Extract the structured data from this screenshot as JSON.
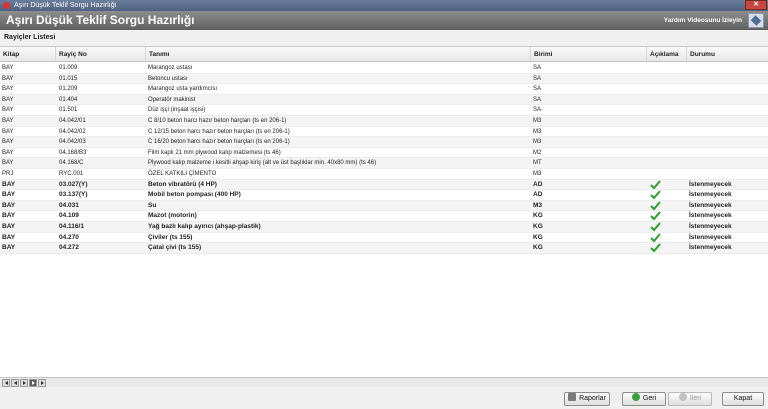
{
  "window": {
    "title": "Aşırı Düşük Teklif Sorgu Hazırlığı"
  },
  "header": {
    "title": "Aşırı Düşük Teklif Sorgu Hazırlığı",
    "video_link": "Yardım Videosunu İzleyin"
  },
  "section": {
    "title": "Rayiçler Listesi"
  },
  "grid": {
    "columns": {
      "kitap": "Kitap",
      "rayic_no": "Rayiç No",
      "tanimi": "Tanımı",
      "birimi": "Birimi",
      "aciklama": "Açıklama",
      "durumu": "Durumu"
    },
    "rows": [
      {
        "kitap": "BAY",
        "rayic_no": "01.009",
        "tanimi": "Marangoz ustası",
        "birimi": "SA",
        "checked": false,
        "durumu": ""
      },
      {
        "kitap": "BAY",
        "rayic_no": "01.015",
        "tanimi": "Betoncu ustası",
        "birimi": "SA",
        "checked": false,
        "durumu": ""
      },
      {
        "kitap": "BAY",
        "rayic_no": "01.209",
        "tanimi": "Marangoz usta yardımcısı",
        "birimi": "SA",
        "checked": false,
        "durumu": ""
      },
      {
        "kitap": "BAY",
        "rayic_no": "01.404",
        "tanimi": "Operatör makinist",
        "birimi": "SA",
        "checked": false,
        "durumu": ""
      },
      {
        "kitap": "BAY",
        "rayic_no": "01.501",
        "tanimi": "Düz işçi (inşaat işçisi)",
        "birimi": "SA",
        "checked": false,
        "durumu": ""
      },
      {
        "kitap": "BAY",
        "rayic_no": "04.042/01",
        "tanimi": "C 8/10 beton harcı hazır beton harçları (ts en 206-1)",
        "birimi": "M3",
        "checked": false,
        "durumu": ""
      },
      {
        "kitap": "BAY",
        "rayic_no": "04.042/02",
        "tanimi": "C 12/15 beton harcı hazır beton harçları (ts en 206-1)",
        "birimi": "M3",
        "checked": false,
        "durumu": ""
      },
      {
        "kitap": "BAY",
        "rayic_no": "04.042/03",
        "tanimi": "C 16/20 beton harcı hazır beton harçları (ts en 206-1)",
        "birimi": "M3",
        "checked": false,
        "durumu": ""
      },
      {
        "kitap": "BAY",
        "rayic_no": "04.168/B3",
        "tanimi": "Film kaplı 21 mm plywood kalıp malzemesi (ts 46)",
        "birimi": "M2",
        "checked": false,
        "durumu": ""
      },
      {
        "kitap": "BAY",
        "rayic_no": "04.168/C",
        "tanimi": "Plywood kalıp malzeme i kesitli ahşap kiriş (alt ve üst başlıklar min. 40x80 mm) (ts 46)",
        "birimi": "MT",
        "checked": false,
        "durumu": ""
      },
      {
        "kitap": "PRJ",
        "rayic_no": "RYC.001",
        "tanimi": "ÖZEL KATKILI ÇİMENTO",
        "birimi": "M3",
        "checked": false,
        "durumu": ""
      },
      {
        "kitap": "BAY",
        "rayic_no": "03.027(Y)",
        "tanimi": "Beton vibratörü (4 HP)",
        "birimi": "AD",
        "checked": true,
        "durumu": "İstenmeyecek"
      },
      {
        "kitap": "BAY",
        "rayic_no": "03.137(Y)",
        "tanimi": "Mobil beton pompası (400 HP)",
        "birimi": "AD",
        "checked": true,
        "durumu": "İstenmeyecek"
      },
      {
        "kitap": "BAY",
        "rayic_no": "04.031",
        "tanimi": "Su",
        "birimi": "M3",
        "checked": true,
        "durumu": "İstenmeyecek"
      },
      {
        "kitap": "BAY",
        "rayic_no": "04.109",
        "tanimi": "Mazot (motorin)",
        "birimi": "KG",
        "checked": true,
        "durumu": "İstenmeyecek"
      },
      {
        "kitap": "BAY",
        "rayic_no": "04.116/1",
        "tanimi": "Yağ bazlı kalıp ayırıcı (ahşap-plastik)",
        "birimi": "KG",
        "checked": true,
        "durumu": "İstenmeyecek"
      },
      {
        "kitap": "BAY",
        "rayic_no": "04.270",
        "tanimi": "Çiviler (ts 155)",
        "birimi": "KG",
        "checked": true,
        "durumu": "İstenmeyecek"
      },
      {
        "kitap": "BAY",
        "rayic_no": "04.272",
        "tanimi": "Çatal çivi (ts 155)",
        "birimi": "KG",
        "checked": true,
        "durumu": "İstenmeyecek"
      }
    ]
  },
  "buttons": {
    "raporlar": "Raporlar",
    "geri": "Geri",
    "ileri": "İleri",
    "kapat": "Kapat"
  },
  "colors": {
    "check": "#2e9e2e",
    "header_bg": "#6e6e6e"
  }
}
